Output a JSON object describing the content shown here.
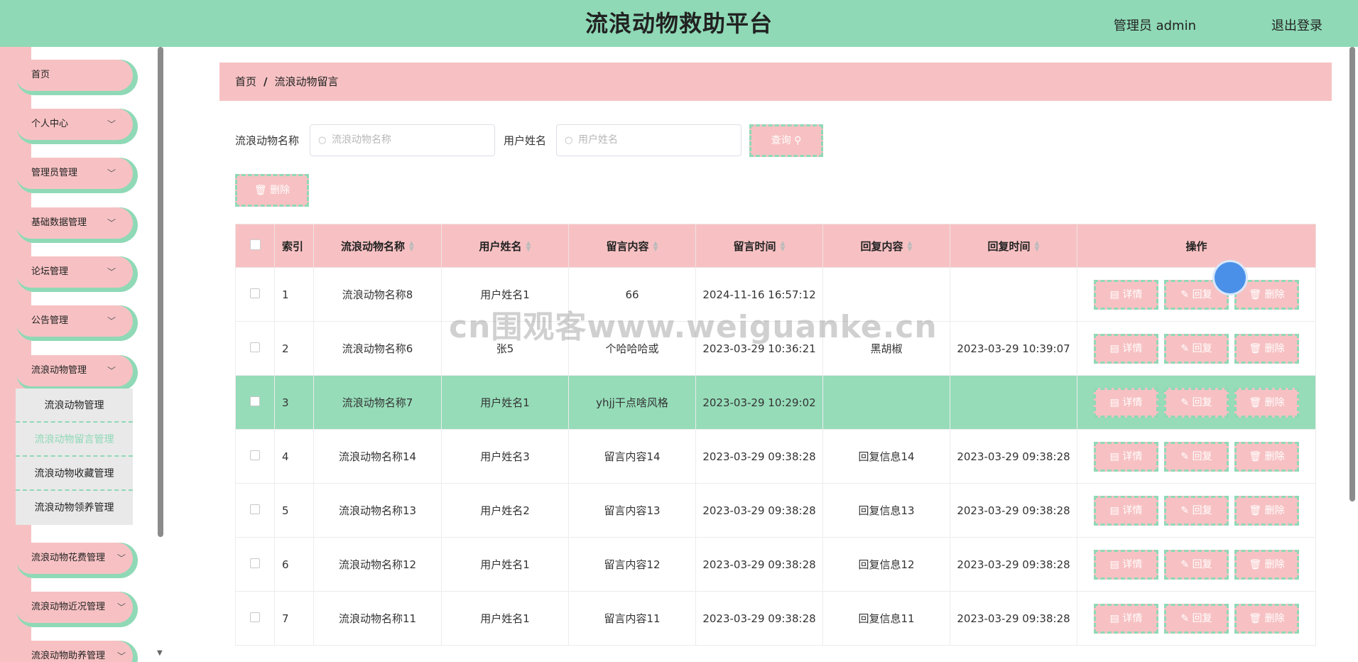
{
  "header": {
    "title": "流浪动物救助平台",
    "user": "管理员 admin",
    "logout": "退出登录"
  },
  "sidebar": {
    "items": [
      {
        "label": "首页",
        "has_arrow": false
      },
      {
        "label": "个人中心",
        "has_arrow": true
      },
      {
        "label": "管理员管理",
        "has_arrow": true
      },
      {
        "label": "基础数据管理",
        "has_arrow": true
      },
      {
        "label": "论坛管理",
        "has_arrow": true
      },
      {
        "label": "公告管理",
        "has_arrow": true
      },
      {
        "label": "流浪动物管理",
        "has_arrow": true
      }
    ],
    "submenu": [
      "流浪动物管理",
      "流浪动物留言管理",
      "流浪动物收藏管理",
      "流浪动物领养管理"
    ],
    "submenu_active": 1,
    "more_items": [
      "流浪动物花费管理",
      "流浪动物近况管理",
      "流浪动物助养管理"
    ]
  },
  "breadcrumb": {
    "home": "首页",
    "separator": "/",
    "current": "流浪动物留言"
  },
  "search": {
    "animal_label": "流浪动物名称",
    "animal_placeholder": "流浪动物名称",
    "user_label": "用户姓名",
    "user_placeholder": "用户姓名",
    "query_button": "查询",
    "delete_button": "删除"
  },
  "table": {
    "columns": [
      "索引",
      "流浪动物名称",
      "用户姓名",
      "留言内容",
      "留言时间",
      "回复内容",
      "回复时间",
      "操作"
    ],
    "action_labels": [
      "详情",
      "回复",
      "删除"
    ],
    "rows": [
      {
        "idx": "1",
        "animal": "流浪动物名称8",
        "user": "用户姓名1",
        "content": "66",
        "time": "2024-11-16 16:57:12",
        "reply": "",
        "reply_time": ""
      },
      {
        "idx": "2",
        "animal": "流浪动物名称6",
        "user": "张5",
        "content": "个哈哈哈或",
        "time": "2023-03-29 10:36:21",
        "reply": "黑胡椒",
        "reply_time": "2023-03-29 10:39:07"
      },
      {
        "idx": "3",
        "animal": "流浪动物名称7",
        "user": "用户姓名1",
        "content": "yhjj干点啥风格",
        "time": "2023-03-29 10:29:02",
        "reply": "",
        "reply_time": ""
      },
      {
        "idx": "4",
        "animal": "流浪动物名称14",
        "user": "用户姓名3",
        "content": "留言内容14",
        "time": "2023-03-29 09:38:28",
        "reply": "回复信息14",
        "reply_time": "2023-03-29 09:38:28"
      },
      {
        "idx": "5",
        "animal": "流浪动物名称13",
        "user": "用户姓名2",
        "content": "留言内容13",
        "time": "2023-03-29 09:38:28",
        "reply": "回复信息13",
        "reply_time": "2023-03-29 09:38:28"
      },
      {
        "idx": "6",
        "animal": "流浪动物名称12",
        "user": "用户姓名1",
        "content": "留言内容12",
        "time": "2023-03-29 09:38:28",
        "reply": "回复信息12",
        "reply_time": "2023-03-29 09:38:28"
      },
      {
        "idx": "7",
        "animal": "流浪动物名称11",
        "user": "用户姓名1",
        "content": "留言内容11",
        "time": "2023-03-29 09:38:28",
        "reply": "回复信息11",
        "reply_time": "2023-03-29 09:38:28"
      }
    ],
    "highlighted_row": 2
  },
  "watermark": "cn围观客www.weiguanke.cn",
  "colors": {
    "header": "#8fd9b6",
    "pink": "#f7c1c3",
    "highlight": "#96dcb9"
  }
}
